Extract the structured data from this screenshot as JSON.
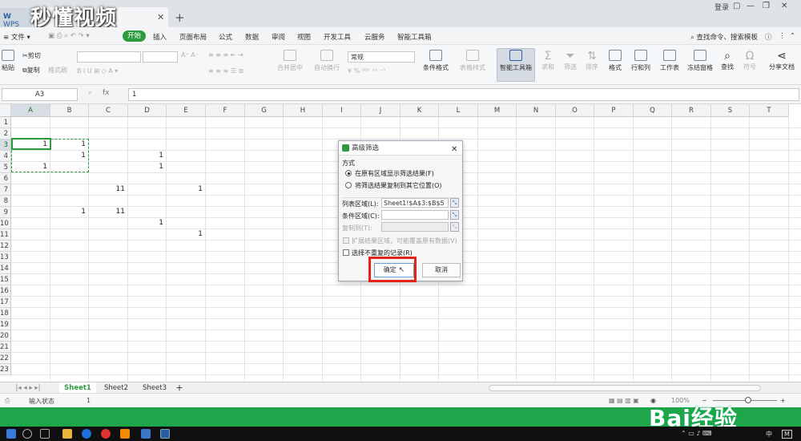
{
  "window": {
    "app_tab": "WPS",
    "watermark_text": "秒懂视频",
    "login": "登录"
  },
  "menu": {
    "file": "文件",
    "start": "开始",
    "items": [
      "插入",
      "页面布局",
      "公式",
      "数据",
      "审阅",
      "视图",
      "开发工具",
      "云服务",
      "智能工具箱"
    ],
    "search": "查找命令、搜索模板"
  },
  "toolbar": {
    "cut": "剪切",
    "copy": "复制",
    "paste": "粘贴",
    "format_painter": "格式刷",
    "merge_center": "合并居中",
    "wrap_text": "自动换行",
    "number_format": "常规",
    "conditional_format": "条件格式",
    "table_style": "表格样式",
    "smart_toolbox": "智能工具箱",
    "sum": "求和",
    "filter": "筛选",
    "sort": "排序",
    "format": "格式",
    "row_col": "行和列",
    "worksheet": "工作表",
    "freeze": "冻结窗格",
    "find": "查找",
    "symbol": "符号",
    "share": "分享文档"
  },
  "formula": {
    "namebox": "A3",
    "fx": "fx",
    "value": "1"
  },
  "columns": [
    "A",
    "B",
    "C",
    "D",
    "E",
    "F",
    "G",
    "H",
    "I",
    "J",
    "K",
    "L",
    "M",
    "N",
    "O",
    "P",
    "Q",
    "R",
    "S",
    "T"
  ],
  "rows": [
    "1",
    "2",
    "3",
    "4",
    "5",
    "6",
    "7",
    "8",
    "9",
    "10",
    "11",
    "12",
    "13",
    "14",
    "15",
    "16",
    "17",
    "18",
    "19",
    "20",
    "21",
    "22",
    "23"
  ],
  "cells": {
    "A3": "1",
    "B3": "1",
    "B4": "1",
    "D4": "1",
    "A5": "1",
    "D5": "1",
    "C7": "11",
    "E7": "1",
    "B9": "1",
    "C9": "11",
    "D10": "1",
    "E11": "1"
  },
  "dialog": {
    "title": "高级筛选",
    "section": "方式",
    "option1": "在原有区域显示筛选结果(F)",
    "option2": "将筛选结果复制到其它位置(O)",
    "list_range_label": "列表区域(L):",
    "list_range_value": "Sheet1!$A$3:$B$5",
    "criteria_label": "条件区域(C):",
    "criteria_value": "",
    "copy_to_label": "复制到(T):",
    "extend_label": "扩展结果区域，可能覆盖原有数据(V)",
    "unique_label": "选择不重复的记录(R)",
    "ok": "确定",
    "cancel": "取消"
  },
  "sheets": [
    "Sheet1",
    "Sheet2",
    "Sheet3"
  ],
  "status": {
    "input_state": "输入状态",
    "value": "1",
    "zoom": "100%"
  },
  "baidu_watermark": "Bai经验",
  "taskbar": {
    "lang": "中",
    "ime": "M"
  }
}
